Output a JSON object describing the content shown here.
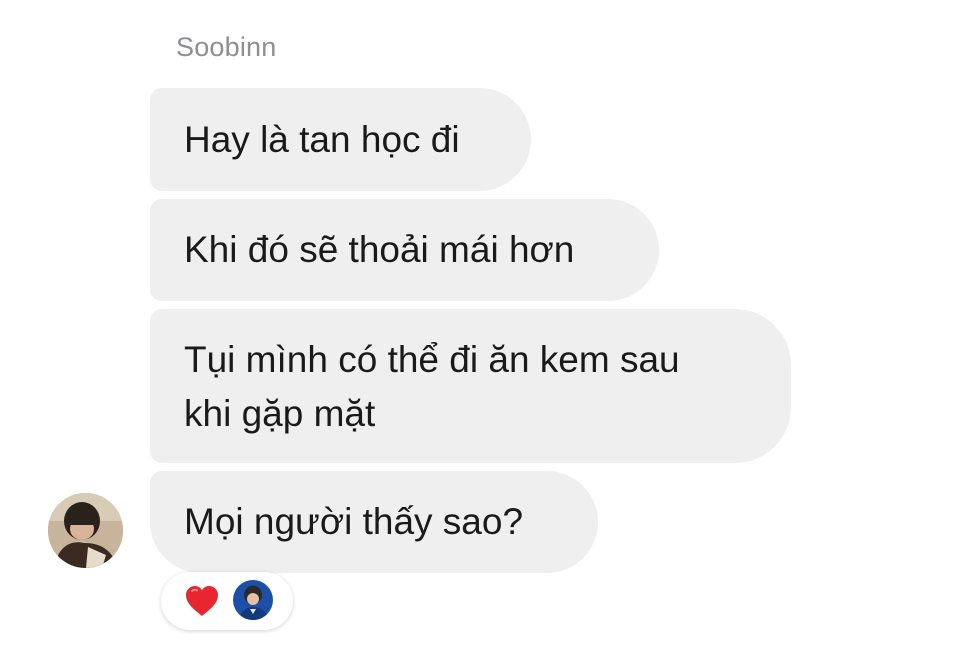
{
  "thread": {
    "sender_name": "Soobinn",
    "messages": [
      {
        "lines": [
          "Hay là tan học đi"
        ]
      },
      {
        "lines": [
          "Khi đó sẽ thoải mái hơn"
        ]
      },
      {
        "lines": [
          "Tụi mình có thể đi ăn kem sau",
          "khi gặp mặt"
        ]
      },
      {
        "lines": [
          "Mọi người thấy sao?"
        ]
      }
    ],
    "reactions": {
      "emoji_icon": "heart-icon",
      "heart_color": "#e8262f",
      "reactor": "reactor-avatar"
    }
  },
  "colors": {
    "bubble_bg": "#efefef",
    "text": "#1a1a1a",
    "sender_name": "#8e8e93"
  }
}
